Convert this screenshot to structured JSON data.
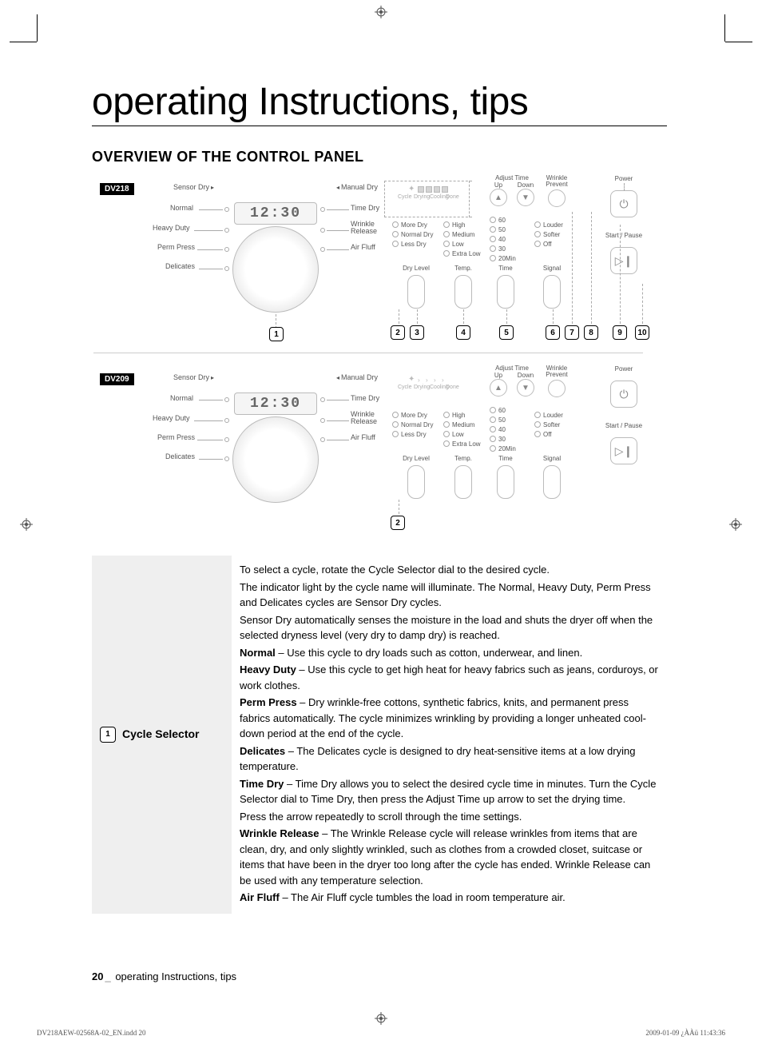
{
  "title": "operating Instructions, tips",
  "section_head": "OVERVIEW OF THE CONTROL PANEL",
  "models": {
    "a": "DV218",
    "b": "DV209"
  },
  "dial": {
    "sensor_label": "Sensor Dry",
    "manual_label": "Manual Dry",
    "time_display": "12:30",
    "left": [
      "Normal",
      "Heavy Duty",
      "Perm Press",
      "Delicates"
    ],
    "right": [
      "Time Dry",
      "Wrinkle\nRelease",
      "Air Fluff"
    ]
  },
  "panel": {
    "progress_labels": [
      "Cycle",
      "Drying",
      "Cooling",
      "Done"
    ],
    "dry_level": {
      "label": "Dry Level",
      "options": [
        "More Dry",
        "Normal Dry",
        "Less Dry"
      ]
    },
    "temp": {
      "label": "Temp.",
      "options": [
        "High",
        "Medium",
        "Low",
        "Extra Low"
      ]
    },
    "time": {
      "label": "Time",
      "options": [
        "60",
        "50",
        "40",
        "30",
        "20Min"
      ]
    },
    "signal": {
      "label": "Signal",
      "options": [
        "Louder",
        "Softer",
        "Off"
      ]
    },
    "adjust_time": {
      "label": "Adjust Time",
      "up": "Up",
      "down": "Down"
    },
    "wrinkle_prevent": "Wrinkle\nPrevent",
    "power": "Power",
    "start_pause": "Start / Pause"
  },
  "callouts": [
    "1",
    "2",
    "3",
    "4",
    "5",
    "6",
    "7",
    "8",
    "9",
    "10"
  ],
  "callouts_b": [
    "2"
  ],
  "table": {
    "row1_callout": "1",
    "row1_label": "Cycle Selector",
    "row1_body": [
      {
        "t": "To select a cycle, rotate the Cycle Selector dial to the desired cycle."
      },
      {
        "t": "The indicator light by the cycle name will illuminate. The Normal, Heavy Duty, Perm Press and Delicates cycles are Sensor Dry cycles."
      },
      {
        "t": "Sensor Dry automatically senses the moisture in the load and shuts the dryer off when the selected dryness level (very dry to damp dry) is reached."
      },
      {
        "b": "Normal",
        "t": " – Use this cycle to dry loads such as cotton, underwear, and linen."
      },
      {
        "b": "Heavy Duty",
        "t": " – Use this cycle to get high heat for heavy fabrics such as jeans, corduroys, or work clothes."
      },
      {
        "b": "Perm Press",
        "t": " – Dry wrinkle-free cottons, synthetic fabrics, knits, and permanent press fabrics automatically. The cycle minimizes wrinkling by providing a longer unheated cool-down period at the end of the cycle."
      },
      {
        "b": "Delicates",
        "t": " – The Delicates cycle is designed to dry heat-sensitive items at a low drying temperature."
      },
      {
        "b": "Time Dry",
        "t": " – Time Dry allows you to select the desired cycle time in minutes. Turn the Cycle Selector dial to Time Dry, then press the Adjust Time up arrow to set the drying time."
      },
      {
        "t": "Press the arrow repeatedly to scroll through the time settings."
      },
      {
        "b": "Wrinkle Release",
        "t": " – The Wrinkle Release cycle will release wrinkles from items that are clean, dry, and only slightly wrinkled, such as clothes from a crowded closet, suitcase or items that have been in the dryer too long after the cycle has ended. Wrinkle Release can be used with any temperature selection."
      },
      {
        "b": "Air Fluff",
        "t": " – The Air Fluff cycle tumbles the load in room temperature air."
      }
    ]
  },
  "footer": {
    "page_num": "20",
    "sep": "_",
    "label": " operating Instructions, tips"
  },
  "doc_meta": {
    "file": "DV218AEW-02568A-02_EN.indd   20",
    "stamp": "2009-01-09   ¿ÀÀü 11:43:36"
  }
}
